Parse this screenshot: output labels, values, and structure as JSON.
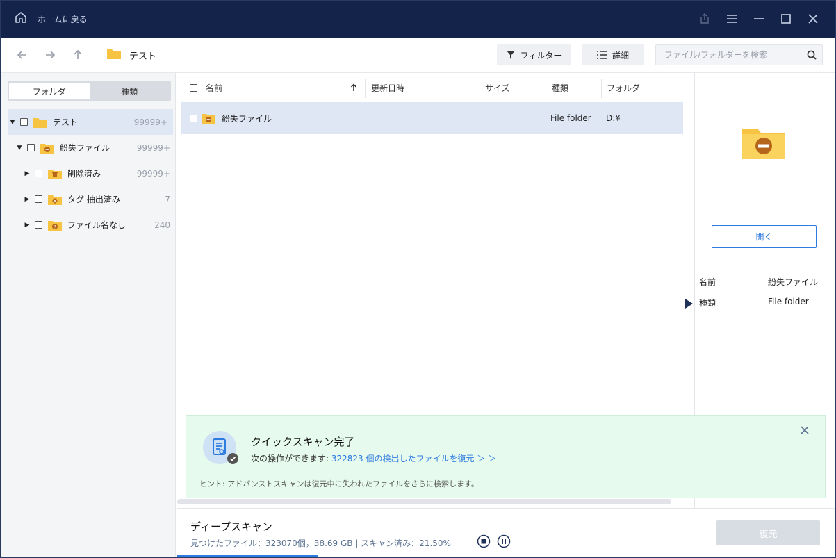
{
  "titlebar": {
    "home_label": "ホームに戻る",
    "bg_color": "#14234a"
  },
  "toolbar": {
    "breadcrumb": "テスト",
    "filter_label": "フィルター",
    "detail_label": "詳細",
    "search_placeholder": "ファイル/フォルダーを検索"
  },
  "sidebar": {
    "tabs": [
      {
        "label": "フォルダ",
        "active": true
      },
      {
        "label": "種類",
        "active": false
      }
    ],
    "tree": [
      {
        "label": "テスト",
        "count": "99999+",
        "icon": "folder-icon"
      },
      {
        "label": "紛失ファイル",
        "count": "99999+",
        "icon": "lost-folder-icon"
      },
      {
        "label": "削除済み",
        "count": "99999+",
        "icon": "deleted-folder-icon"
      },
      {
        "label": "タグ 抽出済み",
        "count": "7",
        "icon": "tag-folder-icon"
      },
      {
        "label": "ファイル名なし",
        "count": "240",
        "icon": "noname-folder-icon"
      }
    ]
  },
  "list": {
    "columns": [
      "名前",
      "更新日時",
      "サイズ",
      "種類",
      "フォルダ"
    ],
    "rows": [
      {
        "name": "紛失ファイル",
        "modified": "",
        "size": "",
        "type": "File folder",
        "folder": "D:¥"
      }
    ]
  },
  "preview": {
    "open_label": "開く",
    "props": [
      {
        "key": "名前",
        "value": "紛失ファイル"
      },
      {
        "key": "種類",
        "value": "File folder"
      }
    ]
  },
  "toast": {
    "title": "クイックスキャン完了",
    "line_prefix": "次の操作ができます: ",
    "link": "322823 個の検出したファイルを復元 ＞ ＞",
    "hint": "ヒント: アドバンストスキャンは復元中に失われたファイルをさらに検索します。"
  },
  "footer": {
    "title": "ディープスキャン",
    "status": "見つけたファイル：323070個，38.69 GB | スキャン済み：21.50%",
    "progress": 0.215,
    "restore_label": "復元"
  },
  "colors": {
    "accent": "#2e7be0",
    "folder": "#f6c343",
    "toast_bg": "#e6fbee"
  }
}
